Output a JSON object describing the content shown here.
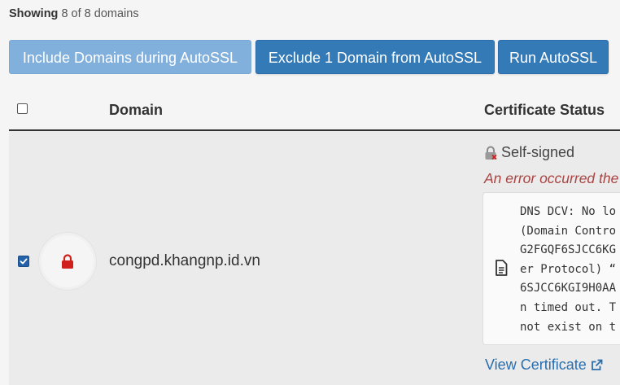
{
  "showing": {
    "label": "Showing",
    "text": "8 of 8 domains"
  },
  "toolbar": {
    "include_label": "Include Domains during AutoSSL",
    "exclude_label": "Exclude 1 Domain from AutoSSL",
    "run_label": "Run AutoSSL"
  },
  "table": {
    "headers": {
      "domain": "Domain",
      "status": "Certificate Status"
    },
    "rows": [
      {
        "checked": true,
        "domain": "congpd.khangnp.id.vn",
        "status": "Self-signed",
        "error": "An error occurred the",
        "details": [
          "DNS DCV: No lo",
          "(Domain Contro",
          "G2FGQF6SJCC6KG",
          "er Protocol) “",
          "6SJCC6KGI9H0AA",
          "n timed out. T",
          "not exist on t"
        ],
        "view_certificate": "View Certificate"
      }
    ]
  },
  "colors": {
    "primary": "#337ab7",
    "primary_disabled": "#81b0dc",
    "error": "#a94442",
    "link": "#2a6ead",
    "lock_red": "#d0201c"
  }
}
